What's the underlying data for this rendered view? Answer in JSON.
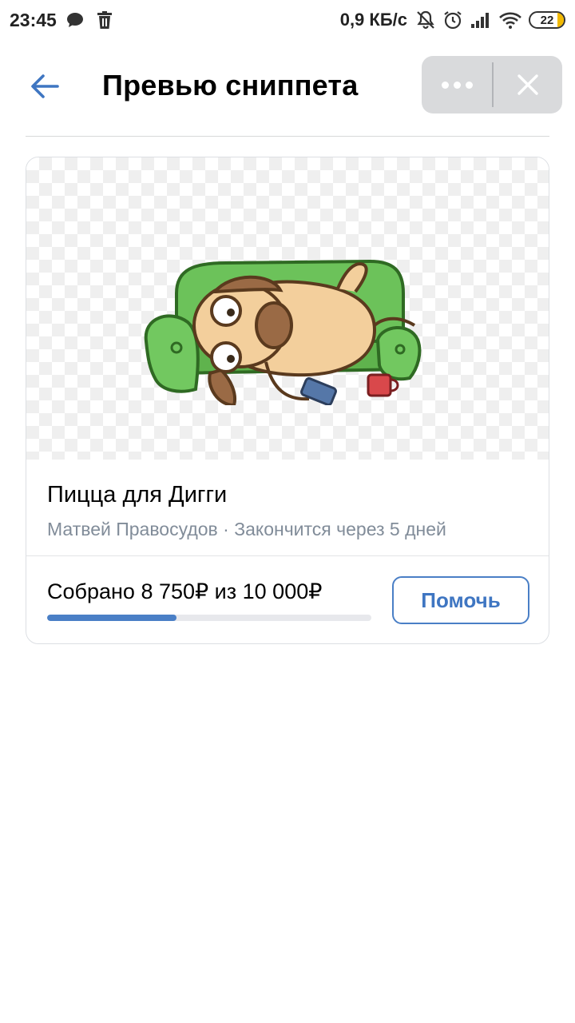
{
  "status_bar": {
    "time": "23:45",
    "network_speed": "0,9 КБ/с",
    "battery_level": "22",
    "icons": [
      "chat-bubble-icon",
      "trash-icon",
      "bell-off-icon",
      "alarm-icon",
      "signal-icon",
      "wifi-icon",
      "battery-icon"
    ]
  },
  "header": {
    "title": "Превью сниппета",
    "back_icon": "arrow-left-icon",
    "more_icon": "more-dots-icon",
    "close_icon": "close-icon"
  },
  "snippet": {
    "image": "dog-on-sofa-sticker",
    "title": "Пицца для Дигги",
    "meta": "Матвей Правосудов · Закончится через 5 дней",
    "collected_text": "Собрано 8 750₽ из 10 000₽",
    "progress_fraction": 0.4,
    "help_button": "Помочь"
  },
  "colors": {
    "accent": "#4a7fc6",
    "secondary_text": "#818c99",
    "pill_bg": "#d9dadc"
  }
}
